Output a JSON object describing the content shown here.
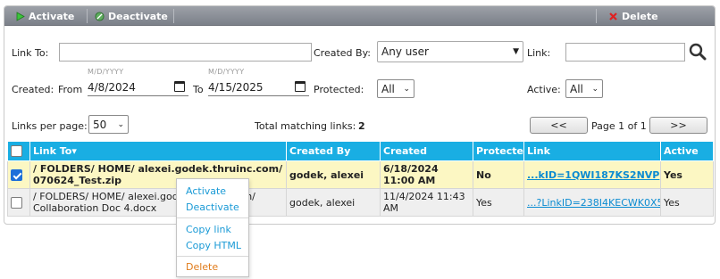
{
  "toolbar": {
    "activate_label": "Activate",
    "deactivate_label": "Deactivate",
    "delete_label": "Delete"
  },
  "filters": {
    "link_to_label": "Link To:",
    "link_to_value": "",
    "created_by_label": "Created By:",
    "created_by_value": "Any user",
    "link_label": "Link:",
    "link_value": "",
    "created_label": "Created:",
    "from_label": "From",
    "date_format_hint": "M/D/YYYY",
    "from_value": "4/8/2024",
    "to_label": "To",
    "to_value": "4/15/2025",
    "protected_label": "Protected:",
    "protected_value": "All",
    "active_label": "Active:",
    "active_value": "All"
  },
  "paging": {
    "links_per_page_label": "Links per page:",
    "links_per_page_value": "50",
    "total_label": "Total matching links:",
    "total_value": "2",
    "prev_label": "<<",
    "next_label": ">>",
    "page_info": "Page 1 of 1"
  },
  "table": {
    "headers": {
      "link_to": "Link To▾",
      "created_by": "Created By",
      "created": "Created",
      "protected": "Protected",
      "link": "Link",
      "active": "Active"
    },
    "rows": [
      {
        "checked": true,
        "link_to": "/ FOLDERS/ HOME/ alexei.godek.thruinc.com/ 070624_Test.zip",
        "created_by": "godek, alexei",
        "created": "6/18/2024 11:00 AM",
        "protected": "No",
        "link": "...kID=1QWI187KS2NVP",
        "active": "Yes"
      },
      {
        "checked": false,
        "link_to": "/ FOLDERS/ HOME/ alexei.godek.thruinc.com/ Collaboration Doc 4.docx",
        "created_by": "godek, alexei",
        "created": "11/4/2024 11:43 AM",
        "protected": "Yes",
        "link": "...?LinkID=238I4KECWK0X5",
        "active": "Yes"
      }
    ]
  },
  "context_menu": {
    "activate": "Activate",
    "deactivate": "Deactivate",
    "copy_link": "Copy link",
    "copy_html": "Copy HTML",
    "delete": "Delete"
  },
  "colors": {
    "header_blue": "#19aee3",
    "selected_row": "#fcf7c3",
    "link_blue": "#0a8bd1",
    "delete_orange": "#e07b1a"
  }
}
